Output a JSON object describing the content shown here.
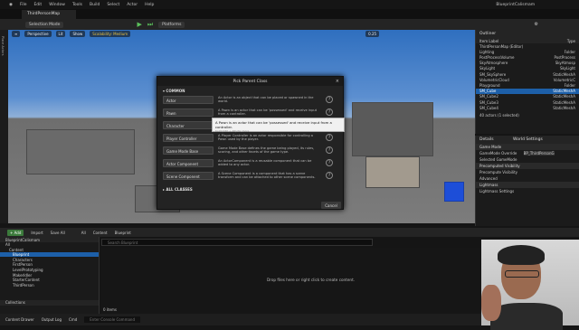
{
  "menu": [
    "File",
    "Edit",
    "Window",
    "Tools",
    "Build",
    "Select",
    "Actor",
    "Help"
  ],
  "project_name": "BlueprintCalismam",
  "map_tab": "ThirdPersonMap",
  "toolbar": {
    "selection_mode": "Selection Mode",
    "platforms": "Platforms"
  },
  "viewport": {
    "perspective": "Perspective",
    "lit": "Lit",
    "show": "Show",
    "scalability": "Scalability: Medium",
    "fov": "0.25"
  },
  "side_label": "Place Actors",
  "outliner": {
    "title": "Outliner",
    "column": "Item Label",
    "column_type": "Type",
    "rows": [
      {
        "label": "ThirdPersonMap (Editor)",
        "type": "",
        "sel": false
      },
      {
        "label": "Lighting",
        "type": "Folder",
        "sel": false
      },
      {
        "label": "PostProcessVolume",
        "type": "PostProcess",
        "sel": false
      },
      {
        "label": "SkyAtmosphere",
        "type": "SkyAtmosp",
        "sel": false
      },
      {
        "label": "SkyLight",
        "type": "SkyLight",
        "sel": false
      },
      {
        "label": "SM_SkySphere",
        "type": "StaticMeshA",
        "sel": false
      },
      {
        "label": "VolumetricCloud",
        "type": "VolumetricC",
        "sel": false
      },
      {
        "label": "Playground",
        "type": "Folder",
        "sel": false
      },
      {
        "label": "SM_Cube",
        "type": "StaticMeshA",
        "sel": true
      },
      {
        "label": "SM_Cube2",
        "type": "StaticMeshA",
        "sel": false
      },
      {
        "label": "SM_Cube3",
        "type": "StaticMeshA",
        "sel": false
      },
      {
        "label": "SM_Cube4",
        "type": "StaticMeshA",
        "sel": false
      }
    ],
    "count": "40 actors (1 selected)"
  },
  "details": {
    "tab1": "Details",
    "tab2": "World Settings",
    "rows": [
      "Game Mode",
      "GameMode Override",
      "Selected GameMode",
      "Precomputed Visibility",
      "Precompute Visibility",
      "Advanced",
      "Lightmass",
      "Lightmass Settings"
    ],
    "override_value": "BP_ThirdPersonG"
  },
  "dialog": {
    "title": "Pick Parent Class",
    "section": "COMMON",
    "classes": [
      {
        "name": "Actor",
        "desc": "An Actor is an object that can be placed or spawned in the world."
      },
      {
        "name": "Pawn",
        "desc": "A Pawn is an actor that can be 'possessed' and receive input from a controller."
      },
      {
        "name": "Character",
        "desc": "A character is a type of Pawn that includes the ability to walk around."
      },
      {
        "name": "Player Controller",
        "desc": "A Player Controller is an actor responsible for controlling a Pawn used by the player."
      },
      {
        "name": "Game Mode Base",
        "desc": "Game Mode Base defines the game being played, its rules, scoring, and other facets of the game type."
      },
      {
        "name": "Actor Component",
        "desc": "An ActorComponent is a reusable component that can be added to any actor."
      },
      {
        "name": "Scene Component",
        "desc": "A Scene Component is a component that has a scene transform and can be attached to other scene components."
      }
    ],
    "all_classes": "ALL CLASSES",
    "cancel": "Cancel",
    "tooltip": "A Pawn is an actor that can be 'possessed' and receive input from a controller.",
    "tooltip_hint": "hold (Ctrl + Alt) for more"
  },
  "content_browser": {
    "add": "+ Add",
    "import": "Import",
    "save_all": "Save All",
    "path": [
      "All",
      "Content",
      "Blueprint"
    ],
    "project": "BlueprintCalismam",
    "folders": [
      {
        "name": "All",
        "sel": false
      },
      {
        "name": "Content",
        "sel": false
      },
      {
        "name": "Blueprint",
        "sel": true
      },
      {
        "name": "Characters",
        "sel": false
      },
      {
        "name": "FirstPerson",
        "sel": false
      },
      {
        "name": "LevelPrototyping",
        "sel": false
      },
      {
        "name": "MakerIdler",
        "sel": false
      },
      {
        "name": "StarterContent",
        "sel": false
      },
      {
        "name": "ThirdPerson",
        "sel": false
      }
    ],
    "search_placeholder": "Search Blueprint",
    "drop_text": "Drop files here or right click to create content.",
    "items": "0 items",
    "collections": "Collections"
  },
  "status": {
    "drawer": "Content Drawer",
    "log": "Output Log",
    "cmd": "Cmd",
    "console_placeholder": "Enter Console Command"
  }
}
